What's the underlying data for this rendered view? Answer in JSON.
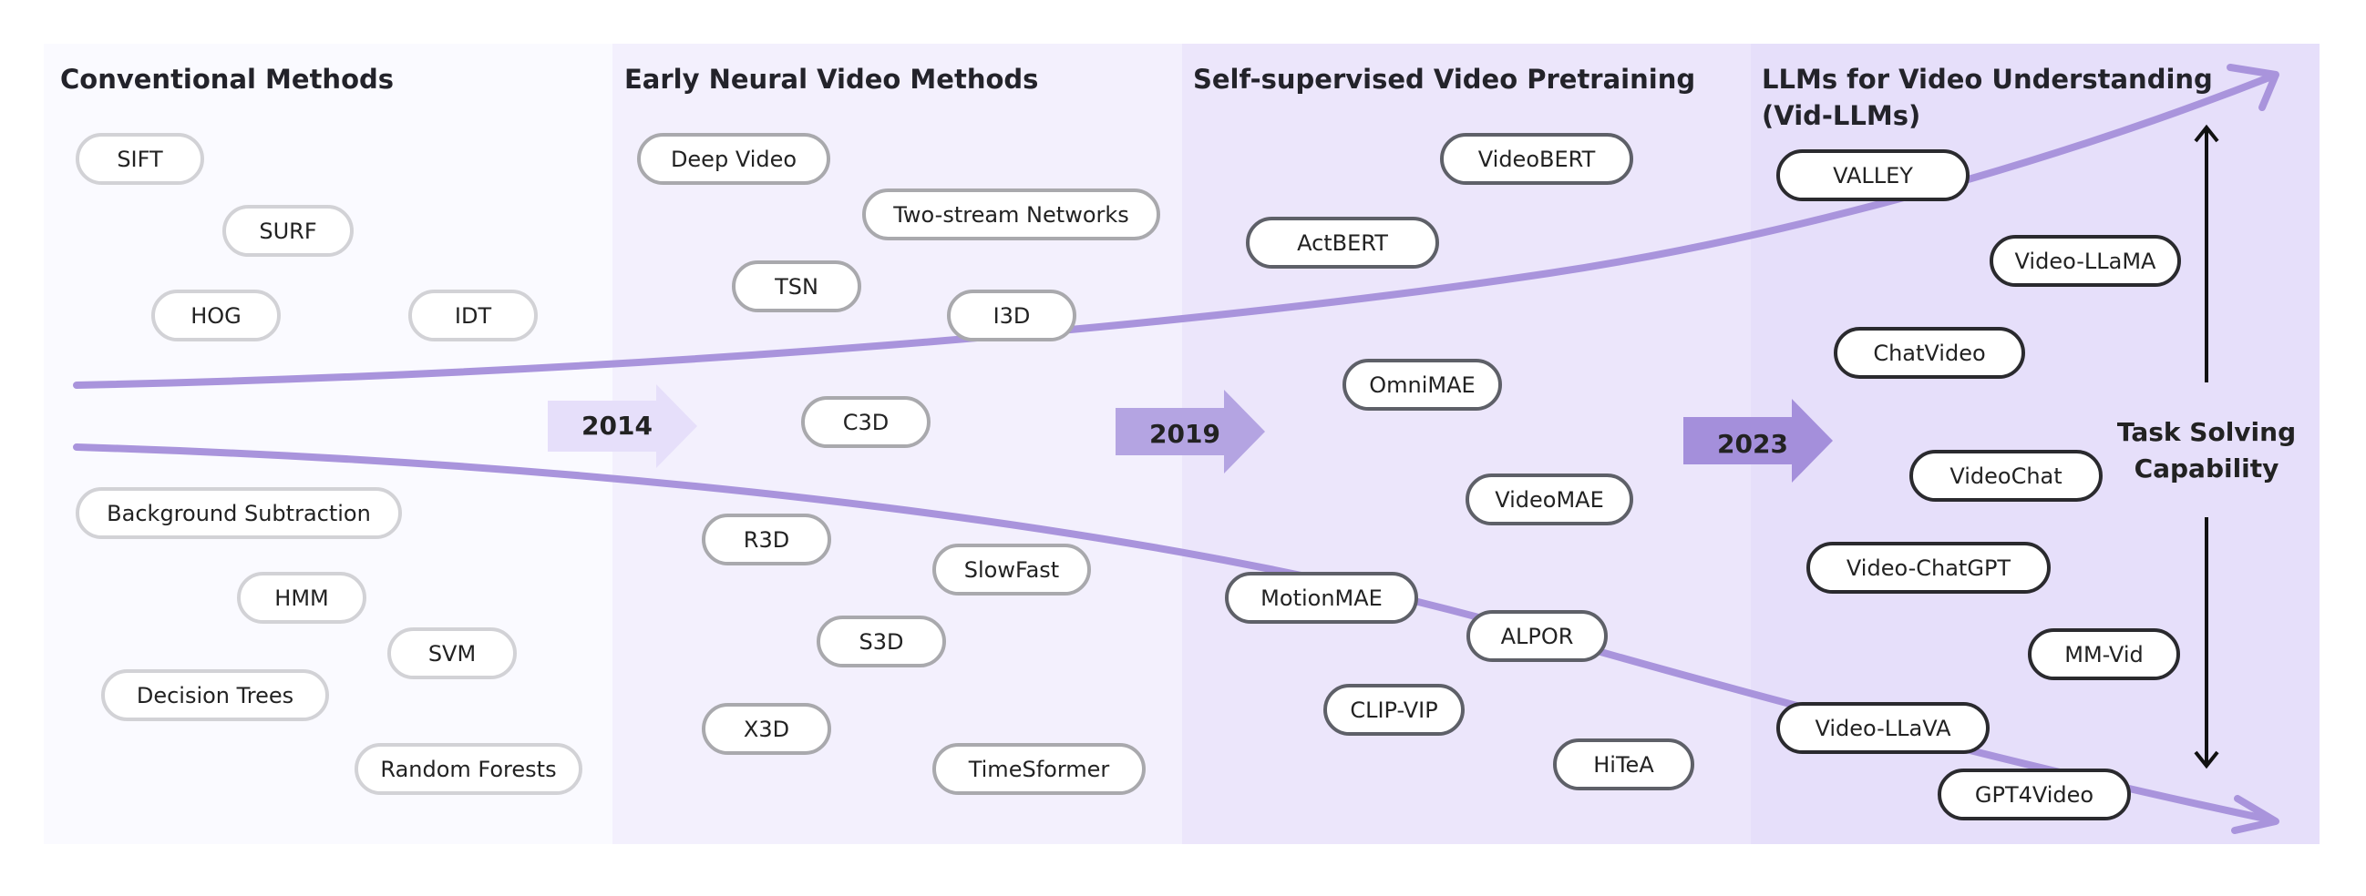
{
  "sections": [
    {
      "title": "Conventional Methods",
      "items": [
        "SIFT",
        "SURF",
        "HOG",
        "IDT",
        "Background Subtraction",
        "HMM",
        "SVM",
        "Decision Trees",
        "Random Forests"
      ]
    },
    {
      "title": "Early Neural Video Methods",
      "items": [
        "Deep Video",
        "Two-stream Networks",
        "TSN",
        "I3D",
        "C3D",
        "R3D",
        "SlowFast",
        "S3D",
        "X3D",
        "TimeSformer"
      ]
    },
    {
      "title": "Self-supervised Video Pretraining",
      "items": [
        "VideoBERT",
        "ActBERT",
        "OmniMAE",
        "VideoMAE",
        "MotionMAE",
        "ALPOR",
        "CLIP-VIP",
        "HiTeA"
      ]
    },
    {
      "title_line1": "LLMs for Video Understanding",
      "title_line2": "(Vid-LLMs)",
      "items": [
        "VALLEY",
        "Video-LLaMA",
        "ChatVideo",
        "VideoChat",
        "Video-ChatGPT",
        "MM-Vid",
        "Video-LLaVA",
        "GPT4Video"
      ]
    }
  ],
  "milestones": [
    "2014",
    "2019",
    "2023"
  ],
  "axis_label": {
    "line1": "Task Solving",
    "line2": "Capability"
  },
  "colors": {
    "curve": "#a994dc",
    "arrow_2014": "#e6dffa",
    "arrow_2019": "#b4a4e2",
    "arrow_2023": "#a48fdb"
  }
}
